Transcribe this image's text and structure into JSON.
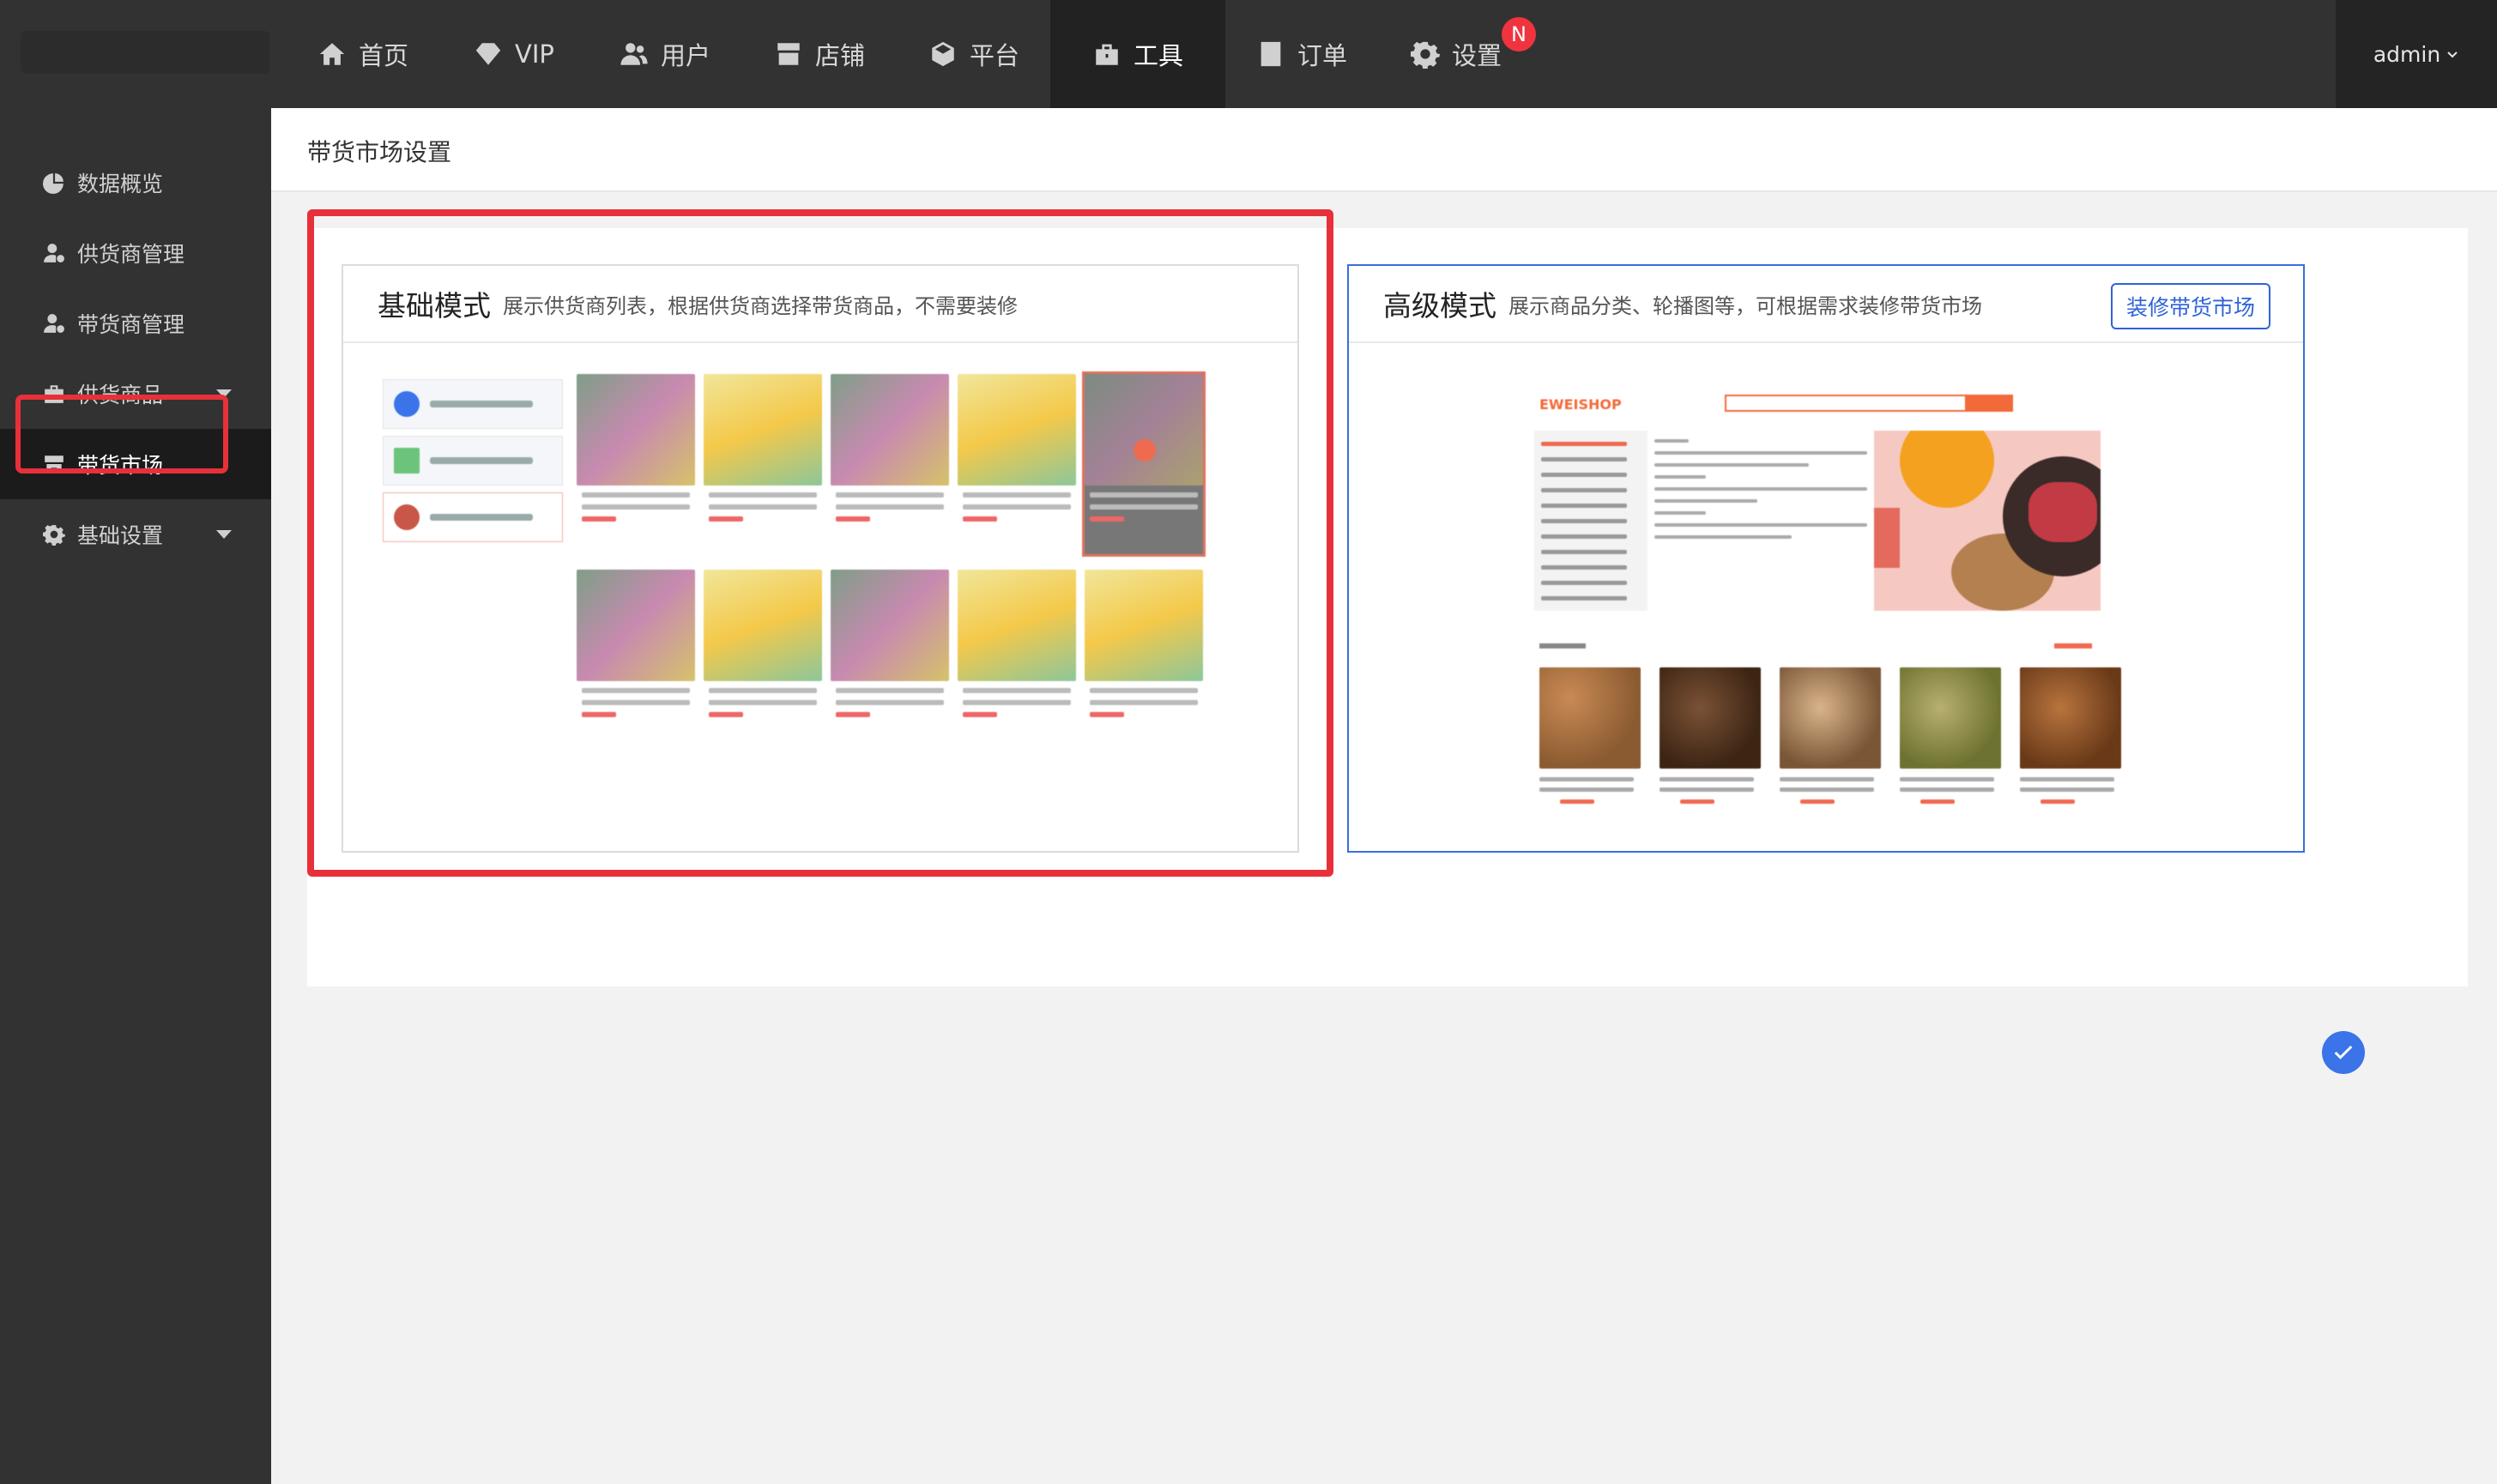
{
  "nav": {
    "items": [
      {
        "label": "首页",
        "icon": "home-icon"
      },
      {
        "label": "VIP",
        "icon": "diamond-icon"
      },
      {
        "label": "用户",
        "icon": "users-icon"
      },
      {
        "label": "店铺",
        "icon": "store-icon"
      },
      {
        "label": "平台",
        "icon": "cube-icon"
      },
      {
        "label": "工具",
        "icon": "toolbox-icon",
        "active": true
      },
      {
        "label": "订单",
        "icon": "order-icon"
      },
      {
        "label": "设置",
        "icon": "gear-icon",
        "badge": "N"
      }
    ],
    "user": "admin"
  },
  "sidebar": {
    "items": [
      {
        "label": "数据概览",
        "icon": "chart-pie-icon"
      },
      {
        "label": "供货商管理",
        "icon": "user-gear-icon"
      },
      {
        "label": "带货商管理",
        "icon": "user-gear-icon"
      },
      {
        "label": "供货商品",
        "icon": "bag-icon",
        "expandable": true
      },
      {
        "label": "带货市场",
        "icon": "store-icon",
        "active": true
      },
      {
        "label": "基础设置",
        "icon": "gear-icon",
        "expandable": true
      }
    ]
  },
  "page": {
    "title": "带货市场设置"
  },
  "modes": {
    "basic": {
      "name": "基础模式",
      "desc": "展示供货商列表，根据供货商选择带货商品，不需要装修"
    },
    "advanced": {
      "name": "高级模式",
      "desc": "展示商品分类、轮播图等，可根据需求装修带货市场",
      "button": "装修带货市场",
      "selected": true,
      "preview_brand": "EWEISHOP"
    }
  },
  "colors": {
    "accent": "#3b74e8",
    "highlight": "#e8303a",
    "topbar": "#323232",
    "brand": "#f26a3a"
  }
}
